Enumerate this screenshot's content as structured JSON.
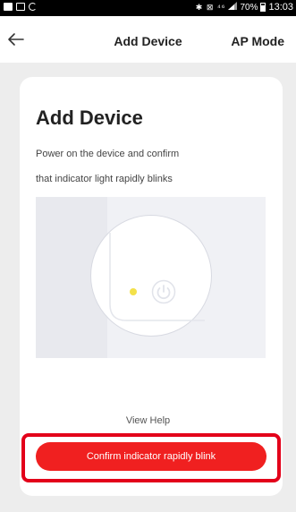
{
  "status_bar": {
    "time": "13:03",
    "battery": "70%",
    "indicators": "✱ ⊠ ⁴⁶",
    "left_icons": [
      "gallery-icon",
      "image-icon",
      "sync-icon"
    ]
  },
  "nav": {
    "title": "Add Device",
    "mode": "AP Mode",
    "back_icon": "arrow-left-icon"
  },
  "card": {
    "title": "Add Device",
    "line1": "Power on the device and confirm",
    "line2": "that indicator light rapidly blinks",
    "illustration": {
      "indicator_color": "#f3e14a",
      "icon": "power-icon"
    },
    "view_help": "View Help",
    "confirm": "Confirm indicator rapidly blink"
  },
  "colors": {
    "accent": "#f02020",
    "highlight": "#e3001a",
    "background": "#ededed"
  }
}
